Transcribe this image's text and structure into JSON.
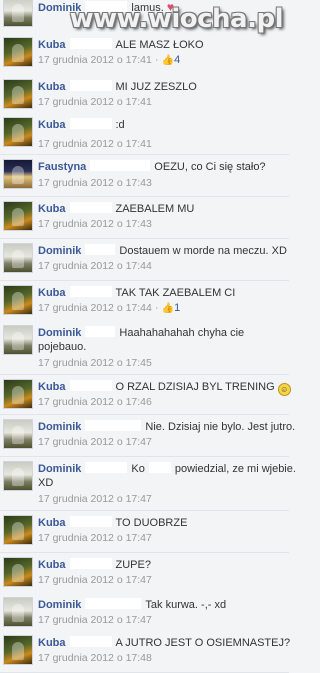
{
  "watermark": "www.wiocha.pl",
  "comments": [
    {
      "author": "Dominik",
      "text": "lamus.",
      "emoji": "♥",
      "time": "",
      "likes": ""
    },
    {
      "author": "Kuba",
      "text": "ALE MASZ ŁOKO",
      "time": "17 grudnia 2012 o 17:41",
      "likes": "4"
    },
    {
      "author": "Kuba",
      "text": "MI JUZ ZESZLO",
      "time": "17 grudnia 2012 o 17:41",
      "likes": ""
    },
    {
      "author": "Kuba",
      "text": ":d",
      "time": "17 grudnia 2012 o 17:41",
      "likes": ""
    },
    {
      "author": "Faustyna",
      "text": "OEZU, co Ci się stało?",
      "time": "17 grudnia 2012 o 17:43",
      "likes": ""
    },
    {
      "author": "Kuba",
      "text": "ZAEBALEM MU",
      "time": "17 grudnia 2012 o 17:43",
      "likes": ""
    },
    {
      "author": "Dominik",
      "text": "Dostauem w morde na meczu. XD",
      "time": "17 grudnia 2012 o 17:44",
      "likes": ""
    },
    {
      "author": "Kuba",
      "text": "TAK TAK ZAEBALEM CI",
      "time": "17 grudnia 2012 o 17:44",
      "likes": "1"
    },
    {
      "author": "Dominik",
      "text": "Haahahahahah chyha cie",
      "text2": "pojebauo.",
      "time": "17 grudnia 2012 o 17:45",
      "likes": ""
    },
    {
      "author": "Kuba",
      "text": "O RZAL DZISIAJ BYL TRENING",
      "emoji": "☺",
      "time": "17 grudnia 2012 o 17:46",
      "likes": ""
    },
    {
      "author": "Dominik",
      "text": "Nie. Dzisiaj nie bylo. Jest jutro.",
      "time": "17 grudnia 2012 o 17:47",
      "likes": ""
    },
    {
      "author": "Dominik",
      "text": "Ko",
      "text_after": "powiedzial, ze mi wjebie.",
      "text2": "XD",
      "time": "17 grudnia 2012 o 17:47",
      "likes": ""
    },
    {
      "author": "Kuba",
      "text": "TO DUOBRZE",
      "time": "17 grudnia 2012 o 17:47",
      "likes": ""
    },
    {
      "author": "Kuba",
      "text": "ZUPE?",
      "time": "17 grudnia 2012 o 17:47",
      "likes": ""
    },
    {
      "author": "Dominik",
      "text": "Tak kurwa. -,- xd",
      "time": "17 grudnia 2012 o 17:47",
      "likes": ""
    },
    {
      "author": "Kuba",
      "text": "A JUTRO JEST O OSIEMNASTEJ?",
      "time": "17 grudnia 2012 o 17:48",
      "likes": ""
    }
  ]
}
